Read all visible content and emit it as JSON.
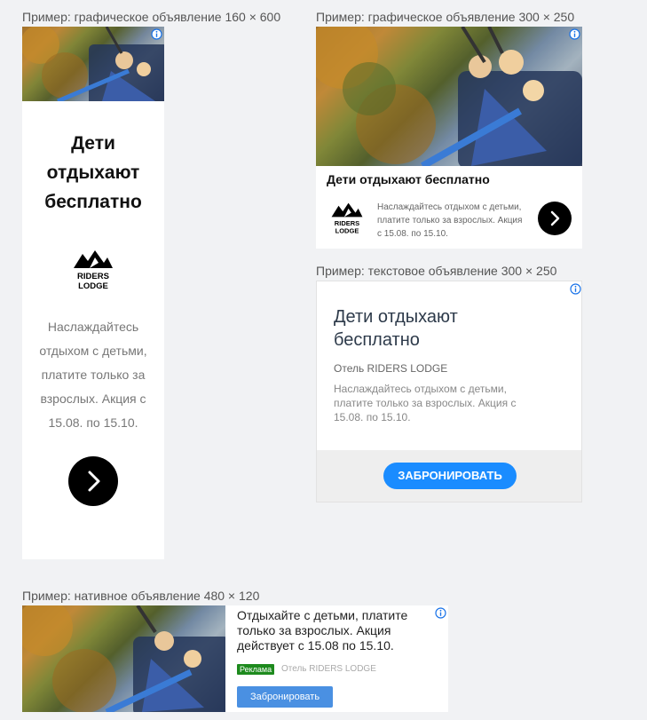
{
  "captions": {
    "banner_160x600": "Пример: графическое объявление 160 × 600",
    "banner_300x250": "Пример: графическое объявление 300 × 250",
    "text_300x250": "Пример: текстовое объявление 300 × 250",
    "native_480x120": "Пример: нативное объявление 480 × 120"
  },
  "ad160": {
    "title": "Дети отдыхают бесплатно",
    "body": "Наслаждайтесь отдыхом с детьми, платите только за взрослых. Акция с 15.08. по 15.10.",
    "logo_text_1": "RIDERS",
    "logo_text_2": "LODGE"
  },
  "ad300img": {
    "title": "Дети отдыхают бесплатно",
    "body": "Наслаждайтесь отдыхом с детьми, платите только за взрослых. Акция с 15.08. по 15.10.",
    "logo_text_1": "RIDERS",
    "logo_text_2": "LODGE"
  },
  "ad300text": {
    "title": "Дети отдыхают бесплатно",
    "advertiser": "Отель RIDERS LODGE",
    "body": "Наслаждайтесь отдыхом с детьми, платите только за взрослых. Акция с 15.08. по 15.10.",
    "button_label": "ЗАБРОНИРОВАТЬ"
  },
  "native": {
    "text": "Отдыхайте с детьми, платите только за взрослых. Акция действует с 15.08 по 15.10.",
    "badge": "Реклама",
    "advertiser": "Отель RIDERS LODGE",
    "button_label": "Забронировать"
  },
  "colors": {
    "page_bg": "#f1f2f4",
    "info_icon": "#1a73e8",
    "cta_blue": "#1a8cff",
    "native_button": "#4a90e2",
    "badge_green": "#1d8a1d",
    "arrow_button": "#000000"
  }
}
